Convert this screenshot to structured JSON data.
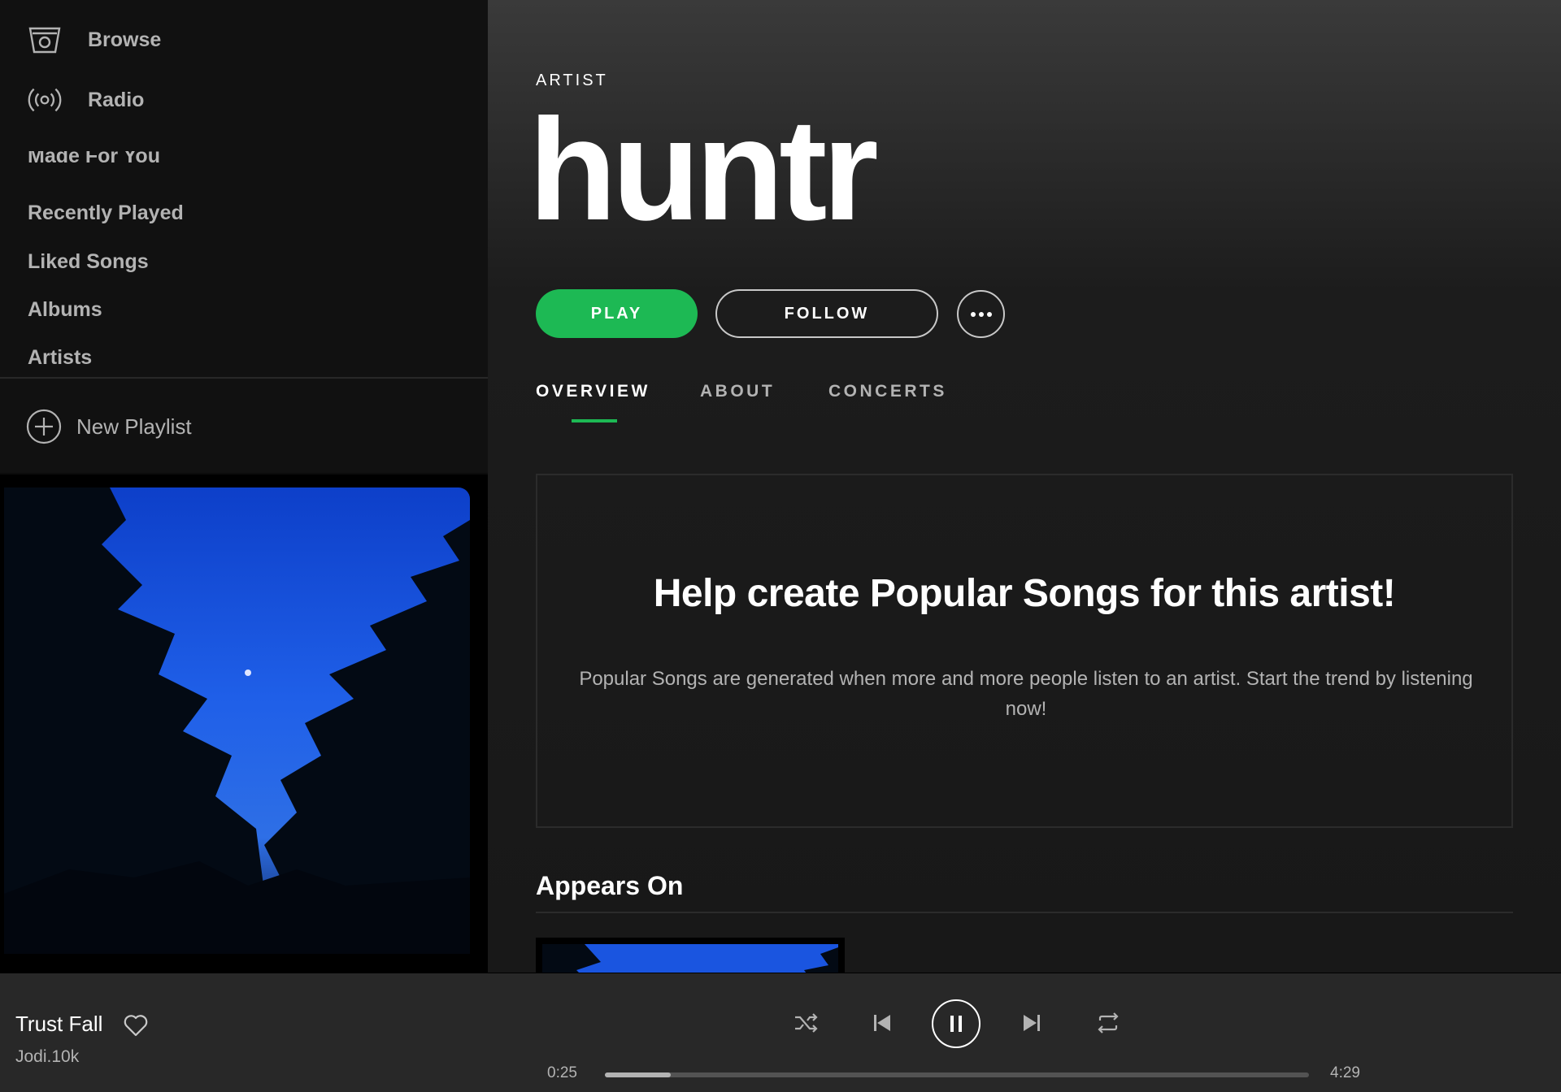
{
  "sidebar": {
    "nav": [
      {
        "label": "Browse",
        "icon": "browse-icon"
      },
      {
        "label": "Radio",
        "icon": "radio-icon"
      }
    ],
    "library_items": [
      "Made For You",
      "Recently Played",
      "Liked Songs",
      "Albums",
      "Artists"
    ],
    "new_playlist_label": "New Playlist"
  },
  "artist": {
    "type_label": "ARTIST",
    "name": "huntr"
  },
  "actions": {
    "play_label": "PLAY",
    "follow_label": "FOLLOW",
    "more_icon": "more-icon"
  },
  "tabs": [
    {
      "label": "OVERVIEW",
      "active": true
    },
    {
      "label": "ABOUT",
      "active": false
    },
    {
      "label": "CONCERTS",
      "active": false
    }
  ],
  "popular": {
    "title": "Help create Popular Songs for this artist!",
    "description": "Popular Songs are generated when more and more people listen to an artist. Start the trend by listening now!"
  },
  "appears_on": {
    "title": "Appears On"
  },
  "player": {
    "track_title": "Trust Fall",
    "track_artist": "Jodi.10k",
    "current_time": "0:25",
    "duration": "4:29",
    "progress": 0.093,
    "is_playing": true
  },
  "colors": {
    "accent": "#1db954",
    "background": "#121212",
    "player_bg": "#282828",
    "text_secondary": "#b3b3b3"
  }
}
